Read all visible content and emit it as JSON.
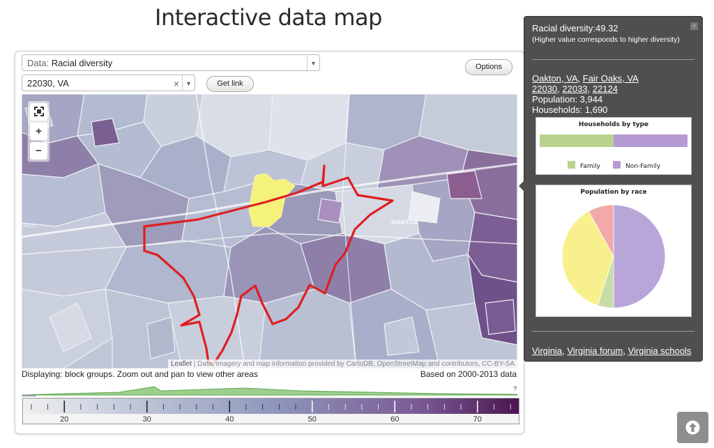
{
  "title": "Interactive data map",
  "controls": {
    "data_prefix": "Data: ",
    "data_value": "Racial diversity",
    "location_value": "22030, VA",
    "clear_glyph": "×",
    "dropdown_glyph": "▼",
    "get_link_label": "Get link",
    "options_label": "Options"
  },
  "map": {
    "zoom_in": "+",
    "zoom_out": "−",
    "attribution_leaflet": "Leaflet",
    "attribution_text": " | Data, imagery and map information provided by CartoDB, OpenStreetMap and contributors, CC-BY-SA",
    "road_labels": [
      "MANTUA",
      "Run"
    ],
    "highlight_color": "#f4f27a",
    "boundary_color": "#e01e1e"
  },
  "status": {
    "displaying": "Displaying: block groups. Zoom out and pan to view other areas",
    "based_on": "Based on 2000-2013 data",
    "histogram_marker": "?"
  },
  "scale": {
    "ticks": [
      "20",
      "30",
      "40",
      "50",
      "60",
      "70"
    ],
    "colors": [
      "#f0f0f0",
      "#4a1550"
    ]
  },
  "info": {
    "close_glyph": "×",
    "metric": "Racial diversity:49.32",
    "note": "(Higher value corresponds to higher diversity)",
    "places": [
      "Oakton, VA",
      "Fair Oaks, VA"
    ],
    "zips": [
      "22030",
      "22033",
      "22124"
    ],
    "population": "Population: 3,944",
    "households": "Households: 1,690",
    "households_chart": {
      "title": "Households by type",
      "series": [
        {
          "name": "Family",
          "value": 0.5,
          "color": "#b9d38f"
        },
        {
          "name": "Non-Family",
          "value": 0.5,
          "color": "#b59ad4"
        }
      ]
    },
    "race_chart": {
      "title": "Population by race",
      "slices": [
        {
          "value": 0.5,
          "color": "#b9a6d9"
        },
        {
          "value": 0.05,
          "color": "#c9dca7"
        },
        {
          "value": 0.37,
          "color": "#f8f08c"
        },
        {
          "value": 0.08,
          "color": "#f3a9aa"
        }
      ]
    },
    "bottom_links": [
      "Virginia",
      "Virginia forum",
      "Virginia schools"
    ]
  }
}
